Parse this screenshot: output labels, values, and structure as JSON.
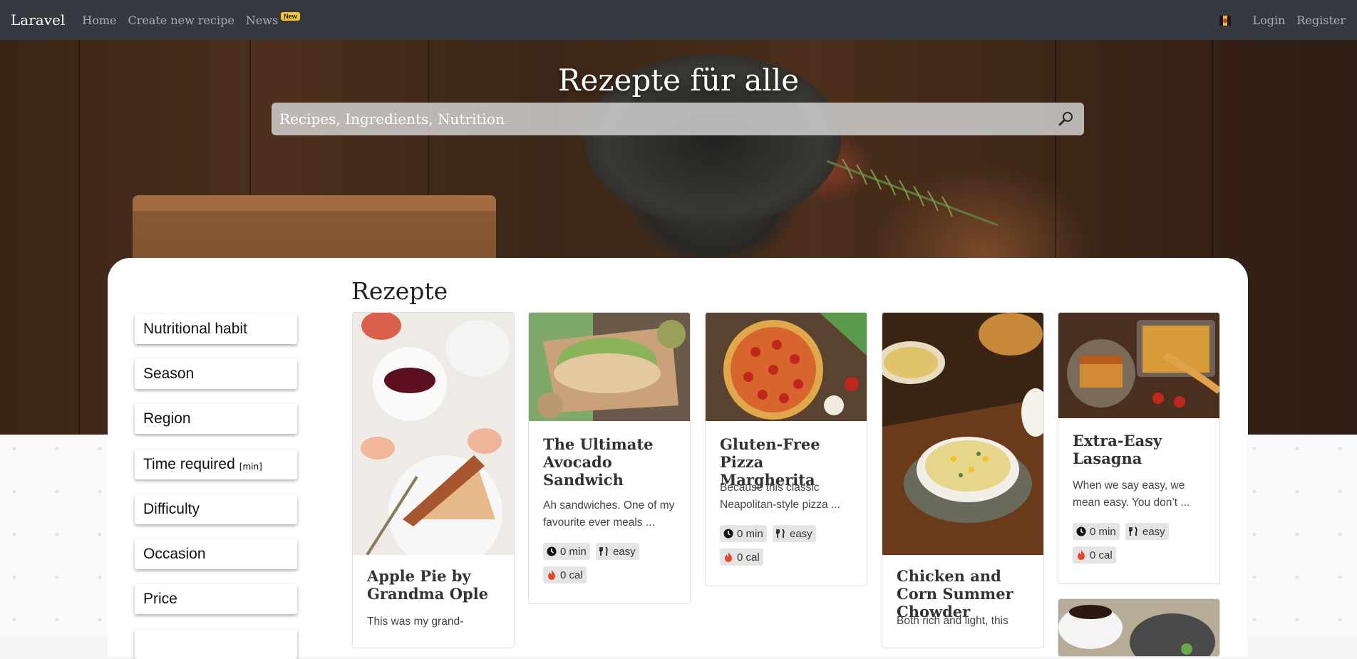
{
  "nav": {
    "brand": "Laravel",
    "links": [
      "Home",
      "Create new recipe",
      "News"
    ],
    "news_badge": "New",
    "login": "Login",
    "register": "Register",
    "flag_icon": "flag-icon"
  },
  "hero": {
    "title": "Rezepte für alle",
    "search_placeholder": "Recipes, Ingredients, Nutrition",
    "search_icon": "search-icon"
  },
  "section": {
    "title": "Rezepte"
  },
  "filters": [
    {
      "label": "Nutritional habit",
      "unit": ""
    },
    {
      "label": "Season",
      "unit": ""
    },
    {
      "label": "Region",
      "unit": ""
    },
    {
      "label": "Time required",
      "unit": "[min]"
    },
    {
      "label": "Difficulty",
      "unit": ""
    },
    {
      "label": "Occasion",
      "unit": ""
    },
    {
      "label": "Price",
      "unit": ""
    }
  ],
  "recipes": [
    {
      "title": "Apple Pie by Grandma Ople",
      "text": "This was my grand-",
      "time": "",
      "difficulty": "",
      "calories": ""
    },
    {
      "title": "The Ultimate Avocado Sandwich",
      "text": "Ah sandwiches. One of my favourite ever meals ...",
      "time": "0 min",
      "difficulty": "easy",
      "calories": "0 cal"
    },
    {
      "title": "Gluten-Free Pizza Margherita",
      "text": "Because this classic Neapolitan-style pizza ...",
      "time": "0 min",
      "difficulty": "easy",
      "calories": "0 cal"
    },
    {
      "title": "Chicken and Corn Summer Chowder",
      "text": "Both rich and light, this",
      "time": "",
      "difficulty": "",
      "calories": ""
    },
    {
      "title": "Extra-Easy Lasagna",
      "text": "When we say easy, we mean easy. You don’t ...",
      "time": "0 min",
      "difficulty": "easy",
      "calories": "0 cal"
    }
  ],
  "colors": {
    "navbar": "#343a40",
    "badge": "#f7c32e",
    "tag_bg": "#e4e4e4",
    "flame": "#e8442a"
  }
}
